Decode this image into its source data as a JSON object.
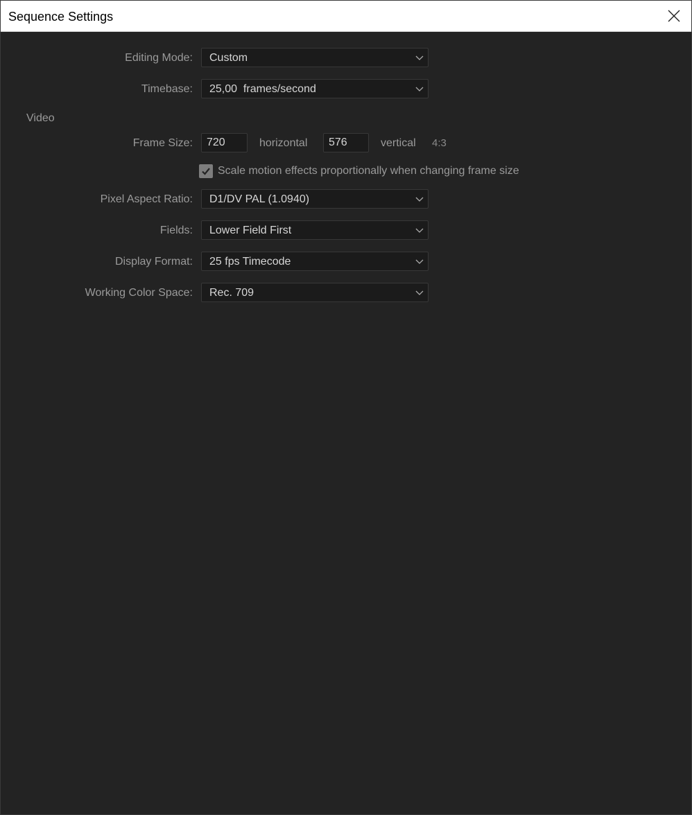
{
  "window": {
    "title": "Sequence Settings"
  },
  "icons": {
    "close": "close-icon",
    "chevron": "chevron-down-icon",
    "check": "checkmark-icon"
  },
  "general": {
    "editing_mode_label": "Editing Mode:",
    "editing_mode_value": "Custom",
    "timebase_label": "Timebase:",
    "timebase_value": "25,00  frames/second"
  },
  "video": {
    "section_label": "Video",
    "frame_size_label": "Frame Size:",
    "frame_width": "720",
    "horizontal_label": "horizontal",
    "frame_height": "576",
    "vertical_label": "vertical",
    "aspect": "4:3",
    "scale_checkbox_label": "Scale motion effects proportionally when changing frame size",
    "scale_checked": true,
    "pixel_aspect_label": "Pixel Aspect Ratio:",
    "pixel_aspect_value": "D1/DV PAL (1.0940)",
    "fields_label": "Fields:",
    "fields_value": "Lower Field First",
    "display_format_label": "Display Format:",
    "display_format_value": "25 fps Timecode",
    "color_space_label": "Working Color Space:",
    "color_space_value": "Rec. 709"
  },
  "colors": {
    "background": "#232323",
    "field_bg": "#1b1b1b",
    "label_text": "#9a9a9a",
    "value_text": "#d6d6d6",
    "checkbox_fill": "#7d7d7d"
  }
}
